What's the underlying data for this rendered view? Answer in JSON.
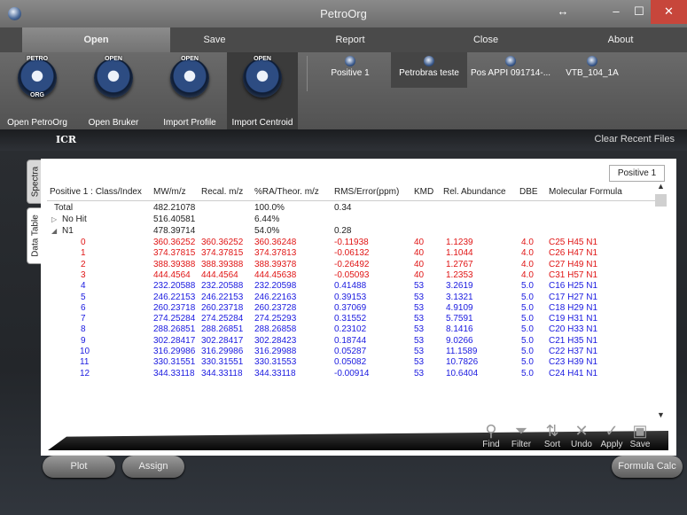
{
  "window": {
    "title": "PetroOrg",
    "resize_glyph": "↔",
    "min_glyph": "–",
    "max_glyph": "☐",
    "close_glyph": "✕"
  },
  "tabs": [
    {
      "label": "Open",
      "active": true
    },
    {
      "label": "Save"
    },
    {
      "label": "Report"
    },
    {
      "label": "Close"
    },
    {
      "label": "About"
    }
  ],
  "ribbon": {
    "buttons": [
      {
        "label": "Open PetroOrg",
        "icon": "petroorg-logo-icon",
        "tag_top": "PETRO",
        "tag_bottom": "ORG"
      },
      {
        "label": "Open Bruker",
        "icon": "open-bruker-icon",
        "tag_top": "OPEN"
      },
      {
        "label": "Import Profile",
        "icon": "import-profile-icon",
        "tag_top": "OPEN"
      },
      {
        "label": "Import Centroid",
        "icon": "import-centroid-icon",
        "tag_top": "OPEN"
      }
    ],
    "recent_files": [
      {
        "label": "Positive 1"
      },
      {
        "label": "Petrobras teste"
      },
      {
        "label": "Pos APPI 091714-..."
      },
      {
        "label": "VTB_104_1A"
      }
    ]
  },
  "section": {
    "title": "ICR",
    "clear_label": "Clear Recent Files"
  },
  "side_tabs": {
    "spectra": "Spectra",
    "data_table": "Data Table"
  },
  "panel_tab": "Positive 1",
  "table": {
    "headers": [
      "Positive 1 : Class/Index",
      "MW/m/z",
      "Recal. m/z",
      "%RA/Theor. m/z",
      "RMS/Error(ppm)",
      "KMD",
      "Rel. Abundance",
      "DBE",
      "Molecular Formula"
    ],
    "summary": [
      {
        "name": "Total",
        "mw": "482.21078",
        "pct": "100.0%",
        "rms": "0.34"
      },
      {
        "name": "No Hit",
        "arrow": "▷",
        "mw": "516.40581",
        "pct": "6.44%",
        "rms": ""
      },
      {
        "name": "N1",
        "arrow": "◢",
        "mw": "478.39714",
        "pct": "54.0%",
        "rms": "0.28"
      }
    ],
    "rows": [
      {
        "idx": "0",
        "mw": "360.36252",
        "recal": "360.36252",
        "theor": "360.36248",
        "err": "-0.11938",
        "kmd": "40",
        "ab": "1.1239",
        "dbe": "4.0",
        "mf": "C25 H45 N1"
      },
      {
        "idx": "1",
        "mw": "374.37815",
        "recal": "374.37815",
        "theor": "374.37813",
        "err": "-0.06132",
        "kmd": "40",
        "ab": "1.1044",
        "dbe": "4.0",
        "mf": "C26 H47 N1"
      },
      {
        "idx": "2",
        "mw": "388.39388",
        "recal": "388.39388",
        "theor": "388.39378",
        "err": "-0.26492",
        "kmd": "40",
        "ab": "1.2767",
        "dbe": "4.0",
        "mf": "C27 H49 N1"
      },
      {
        "idx": "3",
        "mw": "444.4564",
        "recal": "444.4564",
        "theor": "444.45638",
        "err": "-0.05093",
        "kmd": "40",
        "ab": "1.2353",
        "dbe": "4.0",
        "mf": "C31 H57 N1"
      },
      {
        "idx": "4",
        "mw": "232.20588",
        "recal": "232.20588",
        "theor": "232.20598",
        "err": "0.41488",
        "kmd": "53",
        "ab": "3.2619",
        "dbe": "5.0",
        "mf": "C16 H25 N1"
      },
      {
        "idx": "5",
        "mw": "246.22153",
        "recal": "246.22153",
        "theor": "246.22163",
        "err": "0.39153",
        "kmd": "53",
        "ab": "3.1321",
        "dbe": "5.0",
        "mf": "C17 H27 N1"
      },
      {
        "idx": "6",
        "mw": "260.23718",
        "recal": "260.23718",
        "theor": "260.23728",
        "err": "0.37069",
        "kmd": "53",
        "ab": "4.9109",
        "dbe": "5.0",
        "mf": "C18 H29 N1"
      },
      {
        "idx": "7",
        "mw": "274.25284",
        "recal": "274.25284",
        "theor": "274.25293",
        "err": "0.31552",
        "kmd": "53",
        "ab": "5.7591",
        "dbe": "5.0",
        "mf": "C19 H31 N1"
      },
      {
        "idx": "8",
        "mw": "288.26851",
        "recal": "288.26851",
        "theor": "288.26858",
        "err": "0.23102",
        "kmd": "53",
        "ab": "8.1416",
        "dbe": "5.0",
        "mf": "C20 H33 N1"
      },
      {
        "idx": "9",
        "mw": "302.28417",
        "recal": "302.28417",
        "theor": "302.28423",
        "err": "0.18744",
        "kmd": "53",
        "ab": "9.0266",
        "dbe": "5.0",
        "mf": "C21 H35 N1"
      },
      {
        "idx": "10",
        "mw": "316.29986",
        "recal": "316.29986",
        "theor": "316.29988",
        "err": "0.05287",
        "kmd": "53",
        "ab": "11.1589",
        "dbe": "5.0",
        "mf": "C22 H37 N1"
      },
      {
        "idx": "11",
        "mw": "330.31551",
        "recal": "330.31551",
        "theor": "330.31553",
        "err": "0.05082",
        "kmd": "53",
        "ab": "10.7826",
        "dbe": "5.0",
        "mf": "C23 H39 N1"
      },
      {
        "idx": "12",
        "mw": "344.33118",
        "recal": "344.33118",
        "theor": "344.33118",
        "err": "-0.00914",
        "kmd": "53",
        "ab": "10.6404",
        "dbe": "5.0",
        "mf": "C24 H41 N1"
      }
    ]
  },
  "scroll": {
    "up": "▲",
    "down": "▼"
  },
  "toolbar": [
    {
      "label": "Find",
      "icon": "magnifier-icon",
      "glyph": "⚲"
    },
    {
      "label": "Filter",
      "icon": "funnel-icon",
      "glyph": "⏷"
    },
    {
      "label": "Sort",
      "icon": "sort-icon",
      "glyph": "⇅"
    },
    {
      "label": "Undo",
      "icon": "x-icon",
      "glyph": "✕"
    },
    {
      "label": "Apply",
      "icon": "checkmark-icon",
      "glyph": "✓"
    },
    {
      "label": "Save",
      "icon": "save-icon",
      "glyph": "▣"
    }
  ],
  "bottom": {
    "plot": "Plot",
    "assign": "Assign",
    "formula_calc": "Formula Calc"
  },
  "colors": {
    "red_rows": "#e01515",
    "blue_rows": "#1a1ae0",
    "close_button": "#c7463b"
  }
}
